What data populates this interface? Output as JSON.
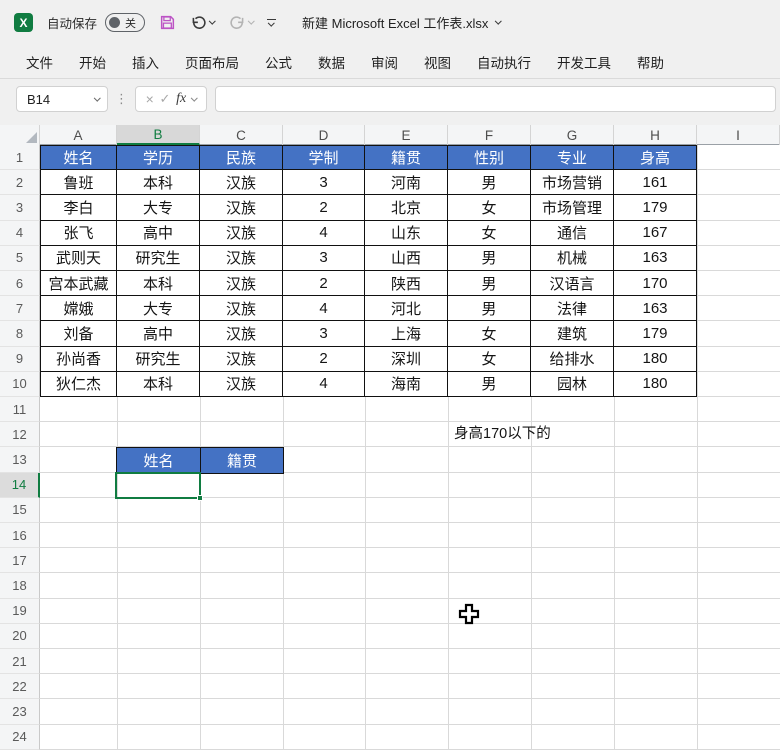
{
  "titlebar": {
    "app_logo": "X",
    "autosave_label": "自动保存",
    "autosave_state": "关",
    "title": "新建 Microsoft Excel 工作表.xlsx"
  },
  "menubar": {
    "tabs": [
      "文件",
      "开始",
      "插入",
      "页面布局",
      "公式",
      "数据",
      "审阅",
      "视图",
      "自动执行",
      "开发工具",
      "帮助"
    ]
  },
  "formula_bar": {
    "name_box": "B14",
    "cancel_glyph": "×",
    "enter_glyph": "✓",
    "fx_label": "fx",
    "formula_value": ""
  },
  "sheet": {
    "column_letters": [
      "A",
      "B",
      "C",
      "D",
      "E",
      "F",
      "G",
      "H",
      "I"
    ],
    "row_numbers": [
      1,
      2,
      3,
      4,
      5,
      6,
      7,
      8,
      9,
      10,
      11,
      12,
      13,
      14,
      15,
      16,
      17,
      18,
      19,
      20,
      21,
      22,
      23,
      24
    ],
    "selected_column": "B",
    "selected_row": 14,
    "active_cell": "B14",
    "table": {
      "headers": [
        "姓名",
        "学历",
        "民族",
        "学制",
        "籍贯",
        "性别",
        "专业",
        "身高"
      ],
      "rows": [
        [
          "鲁班",
          "本科",
          "汉族",
          "3",
          "河南",
          "男",
          "市场营销",
          "161"
        ],
        [
          "李白",
          "大专",
          "汉族",
          "2",
          "北京",
          "女",
          "市场管理",
          "179"
        ],
        [
          "张飞",
          "高中",
          "汉族",
          "4",
          "山东",
          "女",
          "通信",
          "167"
        ],
        [
          "武则天",
          "研究生",
          "汉族",
          "3",
          "山西",
          "男",
          "机械",
          "163"
        ],
        [
          "宫本武藏",
          "本科",
          "汉族",
          "2",
          "陕西",
          "男",
          "汉语言",
          "170"
        ],
        [
          "嫦娥",
          "大专",
          "汉族",
          "4",
          "河北",
          "男",
          "法律",
          "163"
        ],
        [
          "刘备",
          "高中",
          "汉族",
          "3",
          "上海",
          "女",
          "建筑",
          "179"
        ],
        [
          "孙尚香",
          "研究生",
          "汉族",
          "2",
          "深圳",
          "女",
          "给排水",
          "180"
        ],
        [
          "狄仁杰",
          "本科",
          "汉族",
          "4",
          "海南",
          "男",
          "园林",
          "180"
        ]
      ]
    },
    "note_text": "身高170以下的",
    "sub_table": {
      "headers": [
        "姓名",
        "籍贯"
      ]
    },
    "colors": {
      "header_fill": "#4472C4",
      "selection_green": "#107C41",
      "grid_line": "#d9d9d9"
    }
  }
}
